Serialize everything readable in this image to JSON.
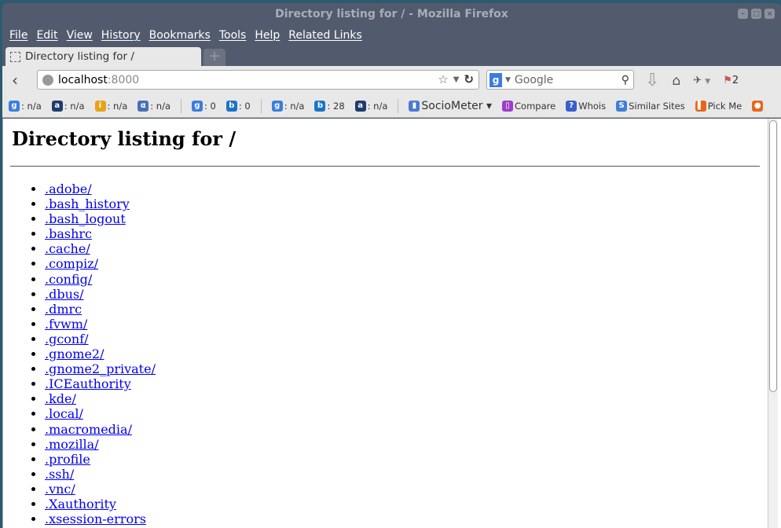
{
  "window": {
    "title": "Directory listing for / - Mozilla Firefox"
  },
  "menu": [
    "File",
    "Edit",
    "View",
    "History",
    "Bookmarks",
    "Tools",
    "Help",
    "Related Links"
  ],
  "tab": {
    "title": "Directory listing for /",
    "new_tab": "+"
  },
  "nav": {
    "url_host": "localhost",
    "url_port": ":8000",
    "search_placeholder": "Google",
    "badge": "2"
  },
  "bookmarks": [
    {
      "icon": "google-pagerank-icon",
      "label": ": n/a",
      "color": "#3b7ddd",
      "glyph": "g"
    },
    {
      "icon": "alexa-icon",
      "label": ": n/a",
      "color": "#1f3b6e",
      "glyph": "a"
    },
    {
      "icon": "dmoz-icon",
      "label": ": n/a",
      "color": "#e8a317",
      "glyph": "i"
    },
    {
      "icon": "alpha-icon",
      "label": ": n/a",
      "color": "#4a6fb5",
      "glyph": "α"
    },
    {
      "icon": "google-index-icon",
      "label": ": 0",
      "color": "#3b7ddd",
      "glyph": "g"
    },
    {
      "icon": "bing-icon",
      "label": ": 0",
      "color": "#1a73c8",
      "glyph": "b"
    },
    {
      "icon": "google-backlinks-icon",
      "label": ": n/a",
      "color": "#3b7ddd",
      "glyph": "g"
    },
    {
      "icon": "bing-backlinks-icon",
      "label": ": 28",
      "color": "#1a73c8",
      "glyph": "b"
    },
    {
      "icon": "alexa-rank-icon",
      "label": ": n/a",
      "color": "#1f3b6e",
      "glyph": "a"
    },
    {
      "icon": "sociometer-icon",
      "label": "SocioMeter ▾",
      "color": "#4a7bd0",
      "glyph": "▮"
    },
    {
      "icon": "compare-icon",
      "label": "Compare",
      "color": "#9b3fc9",
      "glyph": "▯"
    },
    {
      "icon": "whois-icon",
      "label": "Whois",
      "color": "#3a5fcc",
      "glyph": "?"
    },
    {
      "icon": "similar-sites-icon",
      "label": "Similar Sites",
      "color": "#3d7fd6",
      "glyph": "S"
    },
    {
      "icon": "pick-me-icon",
      "label": "Pick Me",
      "color": "#e8661b",
      "glyph": "▌"
    },
    {
      "icon": "more-icon",
      "label": "",
      "color": "#e8661b",
      "glyph": "●"
    }
  ],
  "page": {
    "heading": "Directory listing for /",
    "files": [
      ".adobe/",
      ".bash_history",
      ".bash_logout",
      ".bashrc",
      ".cache/",
      ".compiz/",
      ".config/",
      ".dbus/",
      ".dmrc",
      ".fvwm/",
      ".gconf/",
      ".gnome2/",
      ".gnome2_private/",
      ".ICEauthority",
      ".kde/",
      ".local/",
      ".macromedia/",
      ".mozilla/",
      ".profile",
      ".ssh/",
      ".vnc/",
      ".Xauthority",
      ".xsession-errors"
    ]
  }
}
